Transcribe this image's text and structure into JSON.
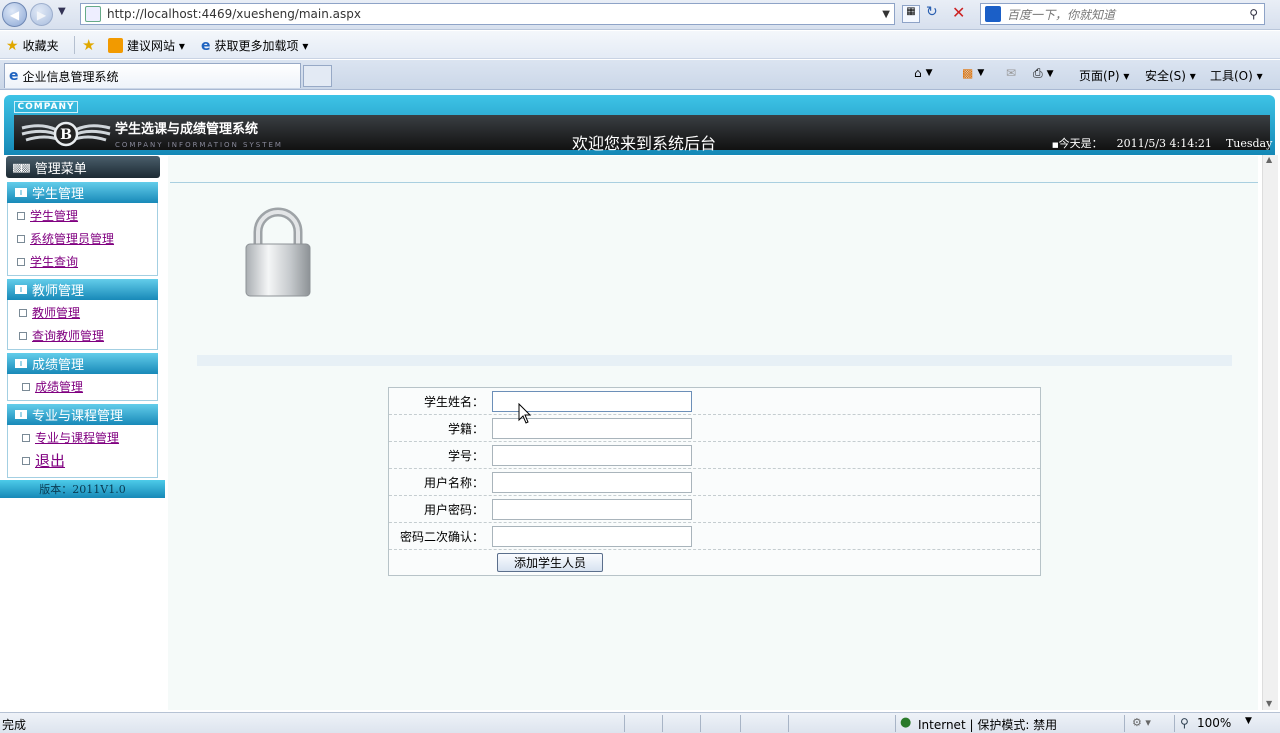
{
  "browser": {
    "url": "http://localhost:4469/xuesheng/main.aspx",
    "search_placeholder": "百度一下，你就知道",
    "favorites_label": "收藏夹",
    "fav_links": [
      "建议网站 ▾",
      "获取更多加载项 ▾"
    ],
    "tab_title": "企业信息管理系统",
    "cmd": {
      "page": "页面(P) ▾",
      "safety": "安全(S) ▾",
      "tools": "工具(O) ▾"
    }
  },
  "header": {
    "company": "COMPANY",
    "system_name": "学生选课与成绩管理系统",
    "system_sub": "COMPANY INFORMATION SYSTEM",
    "welcome": "欢迎您来到系统后台",
    "today_label": "今天是：",
    "date": "2011/5/3 4:14:21",
    "weekday": "Tuesday"
  },
  "sidebar": {
    "title": "管理菜单",
    "groups": [
      {
        "title": "学生管理",
        "items": [
          "学生管理",
          "系统管理员管理",
          "学生查询"
        ]
      },
      {
        "title": "教师管理",
        "items": [
          "教师管理",
          "查询教师管理"
        ]
      },
      {
        "title": "成绩管理",
        "items": [
          "成绩管理"
        ]
      },
      {
        "title": "专业与课程管理",
        "items": [
          "专业与课程管理",
          "退出"
        ]
      }
    ],
    "version": "版本：2011V1.0"
  },
  "form": {
    "fields": [
      {
        "label": "学生姓名：",
        "value": ""
      },
      {
        "label": "学籍：",
        "value": ""
      },
      {
        "label": "学号：",
        "value": ""
      },
      {
        "label": "用户名称：",
        "value": ""
      },
      {
        "label": "用户密码：",
        "value": ""
      },
      {
        "label": "密码二次确认：",
        "value": ""
      }
    ],
    "submit_label": "添加学生人员"
  },
  "status": {
    "text": "完成",
    "zone": "Internet | 保护模式: 禁用",
    "zoom": "100%"
  },
  "colors": {
    "banner": "#1f9ccc",
    "link": "#800080",
    "main_bg": "#f5faf9"
  }
}
